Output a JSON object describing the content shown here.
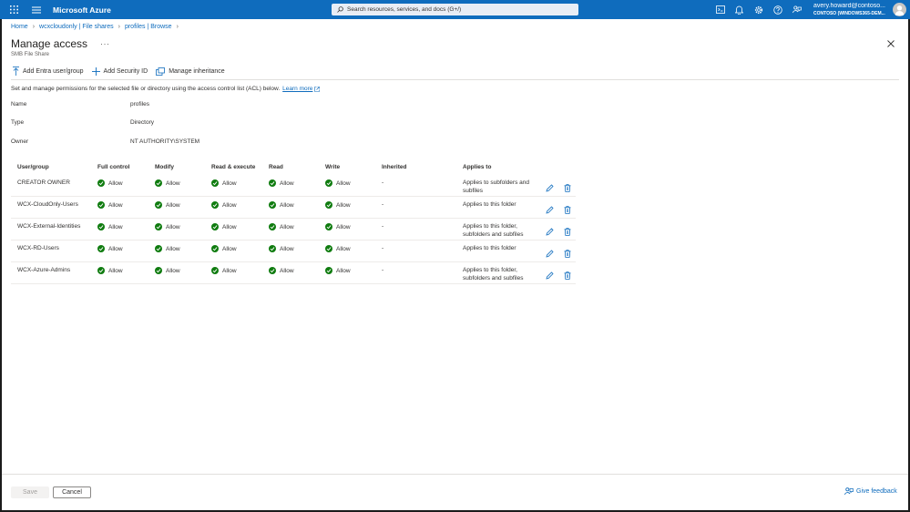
{
  "topbar": {
    "brand": "Microsoft Azure",
    "search_placeholder": "Search resources, services, and docs (G+/)",
    "account_user": "avery.howard@contoso...",
    "account_tenant": "CONTOSO (WINDOWS365-DEM..."
  },
  "breadcrumb": {
    "items": [
      "Home",
      "wcxcloudonly | File shares",
      "profiles | Browse"
    ]
  },
  "page": {
    "title": "Manage access",
    "subtitle": "SMB File Share",
    "more": "···"
  },
  "toolbar": {
    "add_entra": "Add Entra user/group",
    "add_sid": "Add Security ID",
    "manage_inheritance": "Manage inheritance"
  },
  "description": {
    "text": "Set and manage permissions for the selected file or directory using the access control list (ACL) below.",
    "link": "Learn more"
  },
  "properties": [
    {
      "label": "Name",
      "value": "profiles"
    },
    {
      "label": "Type",
      "value": "Directory"
    },
    {
      "label": "Owner",
      "value": "NT AUTHORITY\\SYSTEM"
    }
  ],
  "table": {
    "headers": [
      "User/group",
      "Full control",
      "Modify",
      "Read & execute",
      "Read",
      "Write",
      "Inherited",
      "Applies to"
    ],
    "rows": [
      {
        "user": "CREATOR OWNER",
        "full": "Allow",
        "modify": "Allow",
        "readexec": "Allow",
        "read": "Allow",
        "write": "Allow",
        "inherited": "-",
        "applies": "Applies to subfolders and subfiles"
      },
      {
        "user": "WCX-CloudOnly-Users",
        "full": "Allow",
        "modify": "Allow",
        "readexec": "Allow",
        "read": "Allow",
        "write": "Allow",
        "inherited": "-",
        "applies": "Applies to this folder"
      },
      {
        "user": "WCX-External-Identities",
        "full": "Allow",
        "modify": "Allow",
        "readexec": "Allow",
        "read": "Allow",
        "write": "Allow",
        "inherited": "-",
        "applies": "Applies to this folder, subfolders and subfiles"
      },
      {
        "user": "WCX-RD-Users",
        "full": "Allow",
        "modify": "Allow",
        "readexec": "Allow",
        "read": "Allow",
        "write": "Allow",
        "inherited": "-",
        "applies": "Applies to this folder"
      },
      {
        "user": "WCX-Azure-Admins",
        "full": "Allow",
        "modify": "Allow",
        "readexec": "Allow",
        "read": "Allow",
        "write": "Allow",
        "inherited": "-",
        "applies": "Applies to this folder, subfolders and subfiles"
      }
    ]
  },
  "footer": {
    "save": "Save",
    "cancel": "Cancel",
    "feedback": "Give feedback"
  },
  "colors": {
    "brand": "#0f6cbd",
    "allow": "#107c10"
  },
  "icons": [
    "waffle-icon",
    "hamburger-icon",
    "search-icon",
    "cloud-shell-icon",
    "bell-icon",
    "gear-icon",
    "help-icon",
    "feedback-icon",
    "close-icon",
    "edit-icon",
    "delete-icon",
    "checkmark-icon",
    "external-link-icon"
  ]
}
